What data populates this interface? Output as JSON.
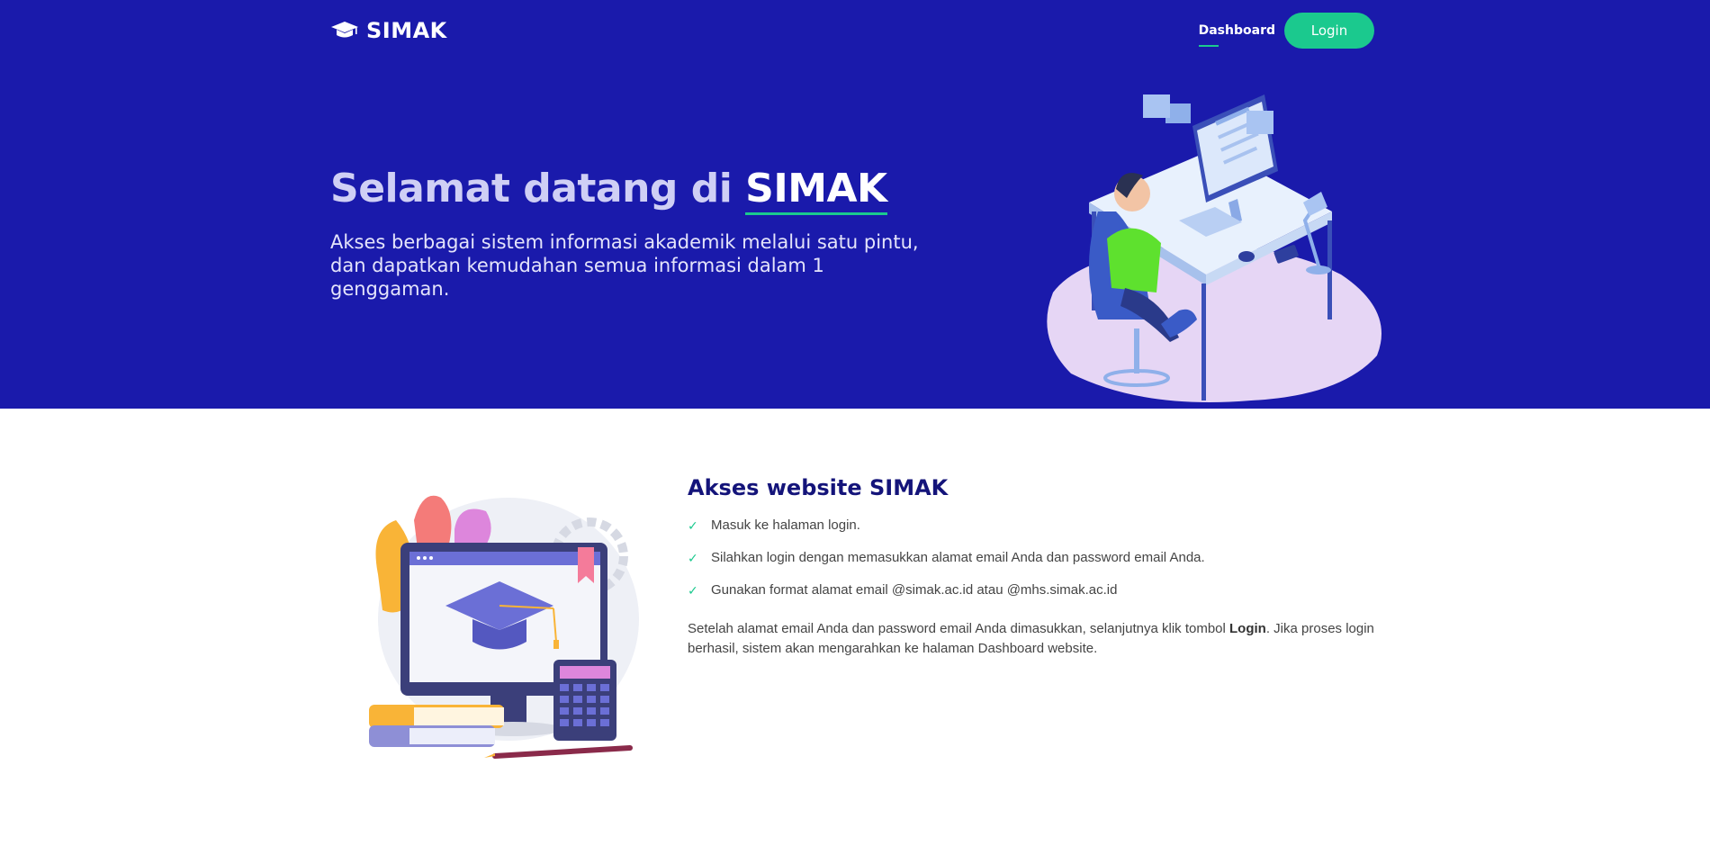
{
  "brand": {
    "name": "SIMAK",
    "icon": "graduation-cap-icon"
  },
  "nav": {
    "dashboard_label": "Dashboard",
    "login_label": "Login"
  },
  "hero": {
    "title_prefix": "Selamat datang di ",
    "title_highlight": "SIMAK",
    "subtitle": "Akses berbagai sistem informasi akademik melalui satu pintu, dan dapatkan kemudahan semua informasi dalam 1 genggaman."
  },
  "info": {
    "title": "Akses website SIMAK",
    "steps": [
      {
        "icon": "check-icon",
        "text": "Masuk ke halaman login."
      },
      {
        "icon": "check-icon",
        "text": "Silahkan login dengan memasukkan alamat email Anda dan password email Anda."
      },
      {
        "icon": "check-icon",
        "text": "Gunakan format alamat email @simak.ac.id atau @mhs.simak.ac.id"
      }
    ],
    "paragraph_before": "Setelah alamat email Anda dan password email Anda dimasukkan, selanjutnya klik tombol ",
    "paragraph_bold": "Login",
    "paragraph_after": ". Jika proses login berhasil, sistem akan mengarahkan ke halaman Dashboard website."
  },
  "colors": {
    "hero_bg": "#1a1aab",
    "accent": "#1bc98e",
    "title_dark": "#14147a"
  }
}
